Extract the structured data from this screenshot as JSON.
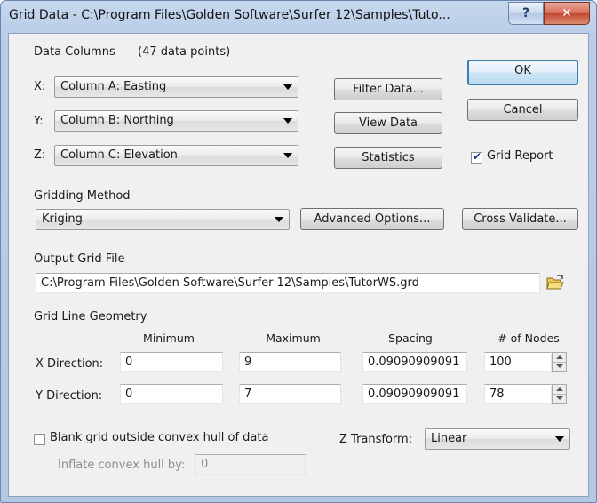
{
  "window": {
    "title": "Grid Data - C:\\Program Files\\Golden Software\\Surfer 12\\Samples\\Tuto...",
    "help_label": "?",
    "close_label": "✕"
  },
  "data_columns": {
    "heading": "Data Columns",
    "count": "(47 data points)",
    "x_label": "X:",
    "x_value": "Column A:  Easting",
    "y_label": "Y:",
    "y_value": "Column B:  Northing",
    "z_label": "Z:",
    "z_value": "Column C:  Elevation"
  },
  "buttons": {
    "filter": "Filter Data...",
    "view": "View Data",
    "statistics": "Statistics",
    "ok": "OK",
    "cancel": "Cancel",
    "advanced": "Advanced Options...",
    "cross_validate": "Cross Validate..."
  },
  "grid_report": {
    "label": "Grid Report",
    "checked": true
  },
  "gridding": {
    "heading": "Gridding Method",
    "method": "Kriging"
  },
  "output": {
    "heading": "Output Grid File",
    "path": "C:\\Program Files\\Golden Software\\Surfer 12\\Samples\\TutorWS.grd",
    "icon": "open-folder-icon"
  },
  "geometry": {
    "heading": "Grid Line Geometry",
    "col_min": "Minimum",
    "col_max": "Maximum",
    "col_spacing": "Spacing",
    "col_nodes": "# of Nodes",
    "x_label": "X Direction:",
    "x_min": "0",
    "x_max": "9",
    "x_spacing": "0.09090909091",
    "x_nodes": "100",
    "y_label": "Y Direction:",
    "y_min": "0",
    "y_max": "7",
    "y_spacing": "0.09090909091",
    "y_nodes": "78"
  },
  "blank": {
    "label": "Blank grid outside convex hull of data",
    "checked": false,
    "inflate_label": "Inflate convex hull by:",
    "inflate_value": "0"
  },
  "z_transform": {
    "label": "Z Transform:",
    "value": "Linear"
  }
}
